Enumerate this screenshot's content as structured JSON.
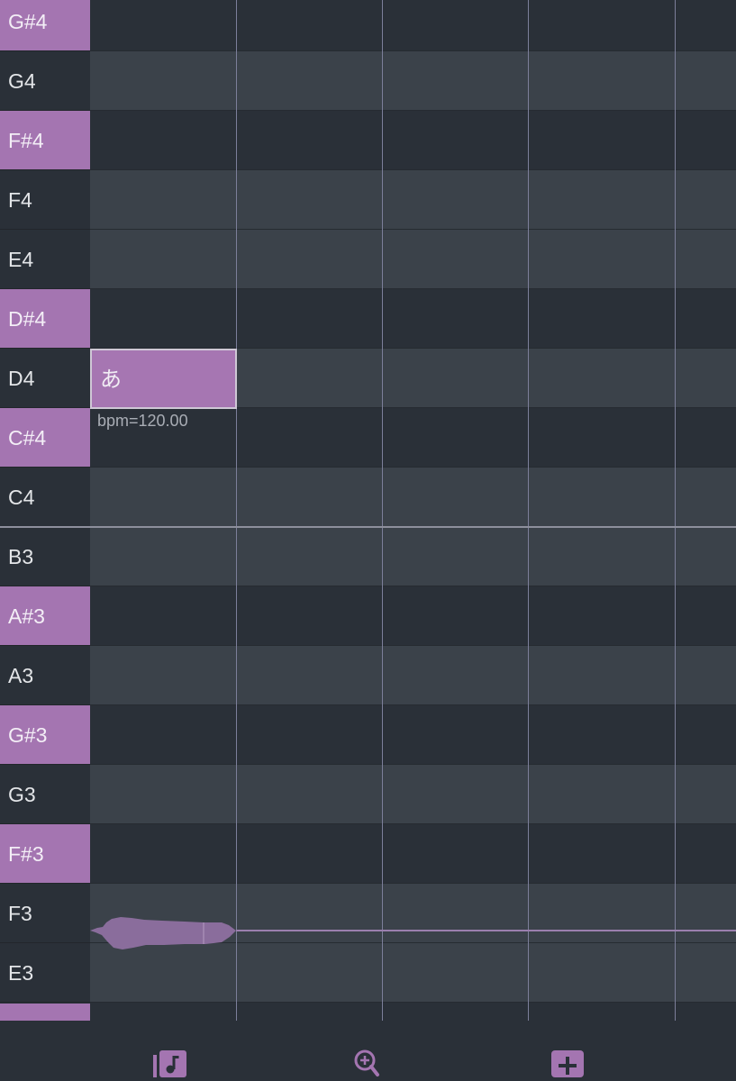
{
  "piano_roll": {
    "keys": [
      {
        "label": "G#4",
        "black": true
      },
      {
        "label": "G4",
        "black": false
      },
      {
        "label": "F#4",
        "black": true
      },
      {
        "label": "F4",
        "black": false
      },
      {
        "label": "E4",
        "black": false
      },
      {
        "label": "D#4",
        "black": true
      },
      {
        "label": "D4",
        "black": false
      },
      {
        "label": "C#4",
        "black": true
      },
      {
        "label": "C4",
        "black": false
      },
      {
        "label": "B3",
        "black": false
      },
      {
        "label": "A#3",
        "black": true
      },
      {
        "label": "A3",
        "black": false
      },
      {
        "label": "G#3",
        "black": true
      },
      {
        "label": "G3",
        "black": false
      },
      {
        "label": "F#3",
        "black": true
      },
      {
        "label": "F3",
        "black": false
      },
      {
        "label": "E3",
        "black": false
      }
    ],
    "note": {
      "lyric": "あ",
      "pitch": "D4"
    },
    "tempo_label": "bpm=120.00"
  },
  "toolbar": {
    "buttons": [
      {
        "name": "note-tool-button",
        "icon": "music-note-icon"
      },
      {
        "name": "zoom-in-button",
        "icon": "zoom-in-icon"
      },
      {
        "name": "add-button",
        "icon": "plus-icon"
      }
    ]
  },
  "colors": {
    "accent": "#a475b1",
    "lane_light": "#3b424a",
    "lane_dark": "#2a3038",
    "grid_line": "#7c7f9a"
  }
}
